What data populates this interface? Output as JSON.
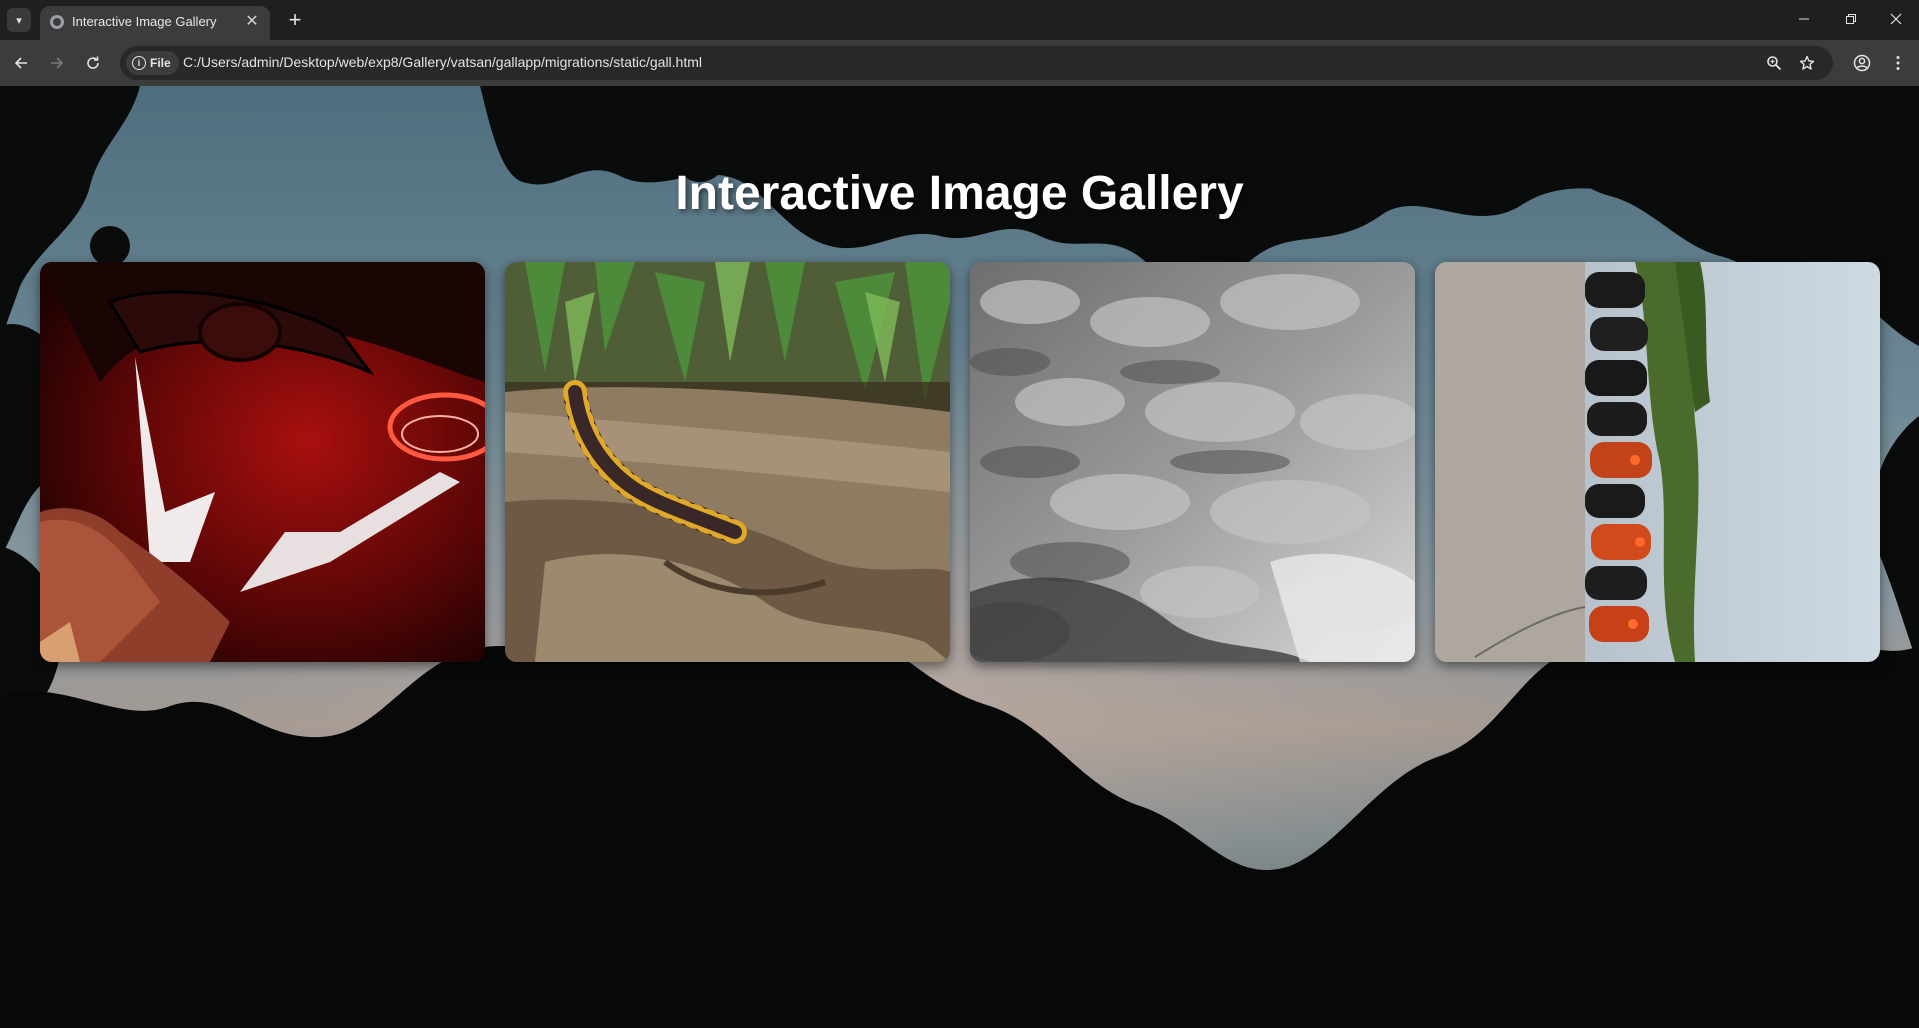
{
  "browser": {
    "tab_title": "Interactive Image Gallery",
    "close_glyph": "✕",
    "new_tab_glyph": "+",
    "site_chip_label": "File",
    "url": "C:/Users/admin/Desktop/web/exp8/Gallery/vatsan/gallapp/migrations/static/gall.html",
    "icons": [
      "tab-search-icon",
      "favicon-icon",
      "close-icon",
      "plus-icon",
      "minimize-icon",
      "restore-icon",
      "window-close-icon",
      "back-arrow-icon",
      "forward-arrow-icon",
      "reload-icon",
      "info-icon",
      "zoom-icon",
      "star-icon",
      "profile-icon",
      "more-vert-icon"
    ]
  },
  "page": {
    "title": "Interactive Image Gallery"
  },
  "gallery": {
    "images": [
      {
        "subject": "red-motorcycle-headlight"
      },
      {
        "subject": "millipede-on-log"
      },
      {
        "subject": "grayscale-clouds"
      },
      {
        "subject": "parked-motorcycles-row"
      }
    ]
  },
  "colors": {
    "chrome_dark": "#1f1f1f",
    "chrome_mid": "#3c3c3c",
    "title_text": "#ffffff"
  }
}
